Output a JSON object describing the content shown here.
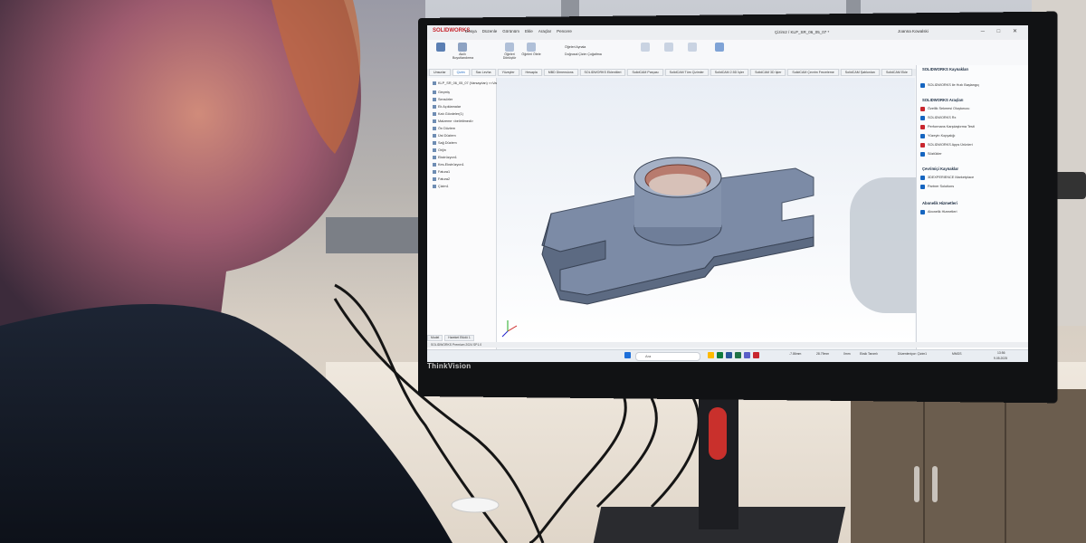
{
  "monitor_brand": "ThinkVision",
  "app": {
    "logo": "SOLIDWORKS",
    "menu": [
      "Dosya",
      "Düzenle",
      "Görünüm",
      "Ekle",
      "Araçlar",
      "Pencere"
    ],
    "document_title": "Çizim2 / KLP_SR_06_05_07 *",
    "user": "Joanna Kowalski",
    "ribbon_items": [
      "Akıllı Boyutlandırma",
      "Öğeleri Dönüştür",
      "Öğeleri Ötele",
      "Doğrusal Çizim Çoğaltma",
      "Öğeleri Aynala",
      "Eskizi Onar",
      "Hızlı Yakala",
      "Anlık Eskiz",
      "Gerçek Ekran Eskizi"
    ],
    "ribbon_text": [
      "Öğeleri Aynala",
      "Doğrusal Çizim Çoğaltma"
    ],
    "tabs": [
      "Unsurlar",
      "Çizim",
      "Sac Levha",
      "Yüzeyler",
      "Hesapla",
      "MBD Dimensions",
      "SOLIDWORKS Eklentileri",
      "SolidCAM Parçası",
      "SolidCAM Tüm Çizimler",
      "SolidCAM 2.5D İşler",
      "SolidCAM 3D İşler",
      "SolidCAM Çevrim Frezeleme",
      "SolidCAM Şablonları",
      "SolidCAM Ekle"
    ],
    "active_tab": "Çizim",
    "tree_items": [
      "KLP_SR_06_05_07 (Varsayılan) <<Varsa",
      "Geçmiş",
      "Sensörler",
      "Ek Açıklamalar",
      "Katı Gövdeler(1)",
      "Malzeme <belirtilmedi>",
      "Ön Düzlem",
      "Üst Düzlem",
      "Sağ Düzlem",
      "Orijin",
      "Ekstrüzyon1",
      "Kes-Ekstrüzyon1",
      "Fatura1",
      "Fatura2",
      "Çizim1"
    ],
    "taskpane": {
      "title": "SOLIDWORKS Kaynakları",
      "sections": [
        {
          "heading": "SOLIDWORKS Araçları",
          "items": [
            "Özellik Sekmesi Oluşturucu",
            "SOLIDWORKS Rx",
            "Performans Karşılaştırma Testi",
            "Yüzeyin Kopyalığı",
            "SOLIDWORKS Apps Ürünleri",
            "Sözlükler"
          ]
        },
        {
          "heading": "Çevrimiçi Kaynaklar",
          "items": [
            "3DEXPERIENCE Marketplace",
            "Partner Solutions"
          ]
        },
        {
          "heading": "Abonelik Hizmetleri",
          "items": [
            "Abonelik Hizmetleri"
          ]
        }
      ],
      "first_item": "SOLIDWORKS ile Hızlı Başlangıç"
    },
    "model_tabs": [
      "Model",
      "Hareket Etüdü 1"
    ],
    "status_left": "SOLIDWORKS Premium 2024 SP1.0",
    "status_right": [
      "-7.86mm",
      "28.79mm",
      "0mm",
      "Eksik Tanımlı",
      "Düzenleniyor: Çizim1",
      "MMGS"
    ],
    "taskbar_search": "Ara",
    "clock": [
      "13:56",
      "9.05.2025"
    ]
  },
  "colors": {
    "accent": "#1565c0",
    "solidworks_red": "#c8262e",
    "part": "#7c8ba6",
    "stand_red": "#c9302c"
  }
}
